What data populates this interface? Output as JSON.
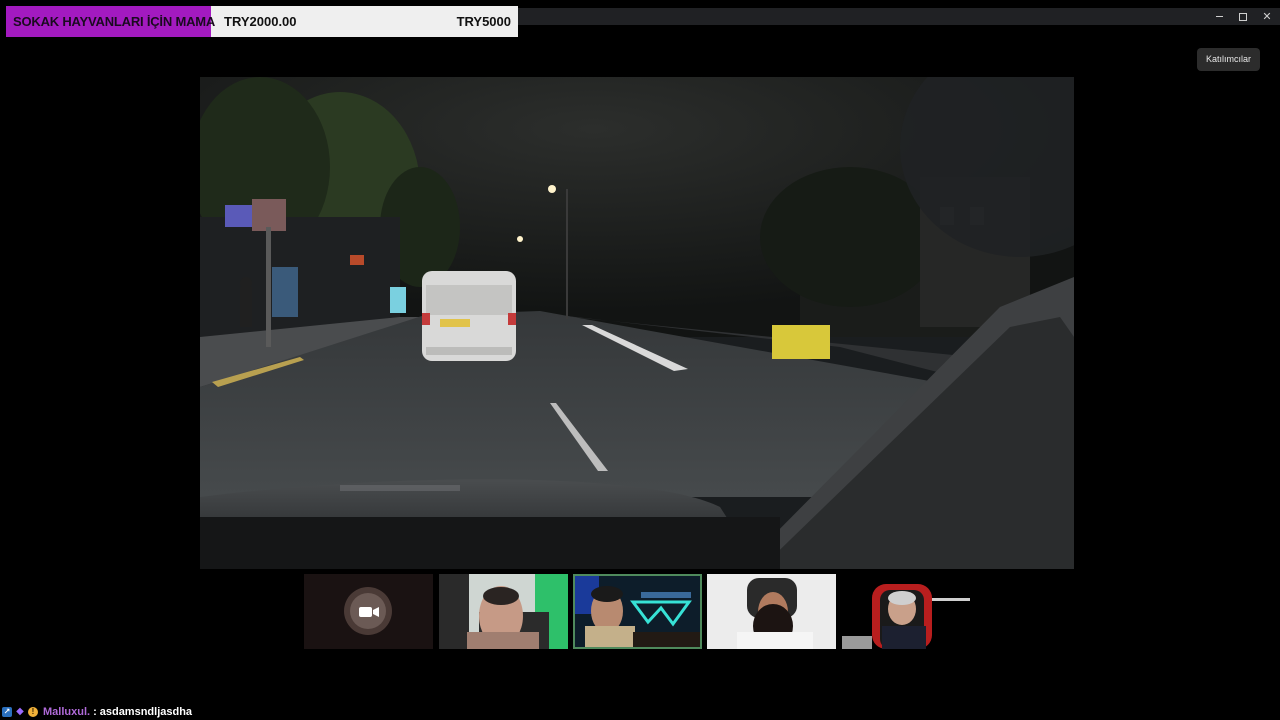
{
  "donation_goal": {
    "title": "SOKAK HAYVANLARI İÇİN MAMA",
    "current": "TRY2000.00",
    "target": "TRY5000",
    "progress": 0.4
  },
  "window": {
    "controls": [
      "minimize",
      "maximize",
      "close"
    ]
  },
  "participants_button": {
    "label": "Katılımcılar"
  },
  "main_video": {
    "content": "night dashcam drive",
    "van_plate": "YELLOW PLATE"
  },
  "thumbnails": [
    {
      "id": "cam-off",
      "camera_on": false,
      "icon": "video-camera-icon"
    },
    {
      "id": "p2",
      "camera_on": true
    },
    {
      "id": "p3",
      "camera_on": true,
      "active": true
    },
    {
      "id": "p4",
      "camera_on": true
    },
    {
      "id": "p5",
      "camera_on": true
    }
  ],
  "chat": {
    "username": "Malluxul.",
    "separator": ":",
    "message": "asdamsndljasdha",
    "badges": [
      "blue-badge-icon",
      "purple-diamond-icon",
      "gold-coin-icon"
    ]
  },
  "colors": {
    "goal_fill": "#a31ac0",
    "goal_bg": "#efefef",
    "username": "#b06ad9",
    "active_outline": "#4f8a5c"
  }
}
